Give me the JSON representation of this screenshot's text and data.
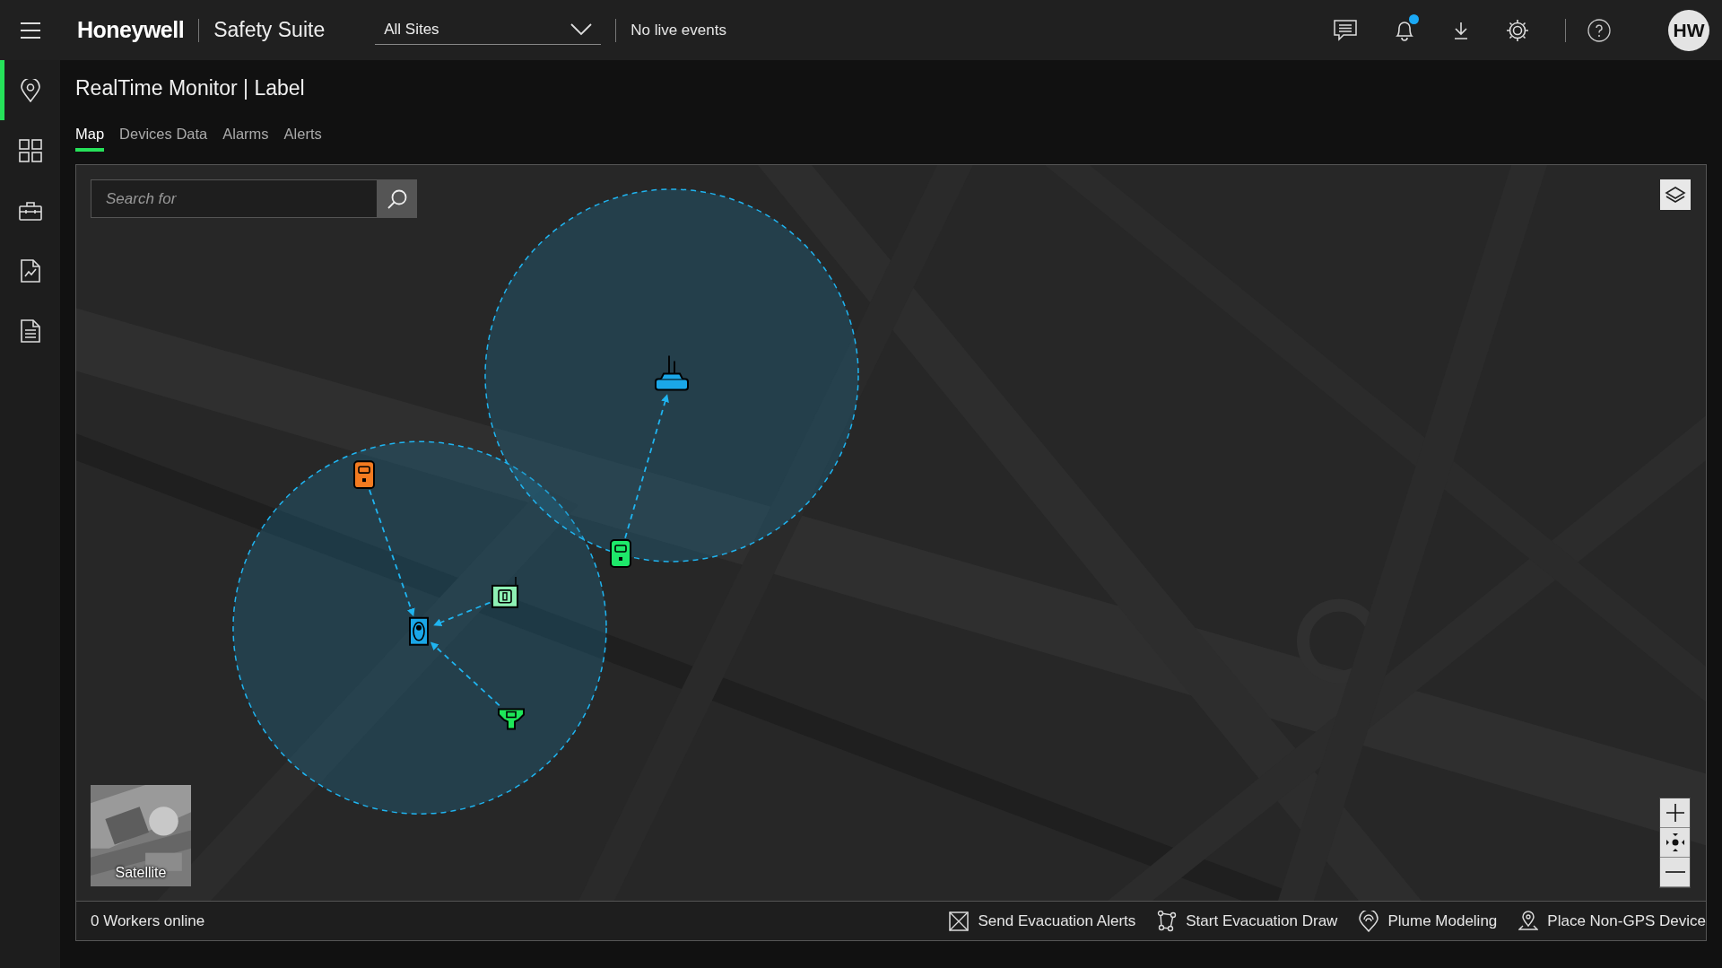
{
  "header": {
    "logo": "Honeywell",
    "app_name": "Safety Suite",
    "site_select": {
      "value": "All Sites"
    },
    "live_status": "No live events",
    "notifications_unread": true,
    "avatar": "HW"
  },
  "sidebar": {
    "items": [
      {
        "kind": "map",
        "selected": true
      },
      {
        "kind": "dashboard",
        "selected": false
      },
      {
        "kind": "toolbox",
        "selected": false
      },
      {
        "kind": "report",
        "selected": false
      },
      {
        "kind": "document",
        "selected": false
      }
    ]
  },
  "page": {
    "title": "RealTime Monitor | Label"
  },
  "tabs": [
    {
      "label": "Map",
      "selected": true
    },
    {
      "label": "Devices Data",
      "selected": false
    },
    {
      "label": "Alarms",
      "selected": false
    },
    {
      "label": "Alerts",
      "selected": false
    }
  ],
  "map": {
    "kind": "picture",
    "search": {
      "placeholder": "Search for"
    },
    "basemap_toggle": {
      "label": "Satellite"
    },
    "devices": [
      {
        "kind": "portable",
        "color": "#f47b20"
      },
      {
        "kind": "worker",
        "color": "#1aa7e8"
      },
      {
        "kind": "area-monitor",
        "color": "#8ef0b4"
      },
      {
        "kind": "fixed-sensor",
        "color": "#1ee85a"
      },
      {
        "kind": "portable",
        "color": "#1ee86a"
      },
      {
        "kind": "gateway",
        "color": "#1aa7e8"
      }
    ]
  },
  "footer": {
    "workers_online": "0 Workers online",
    "actions": [
      {
        "kind": "evacuation-alerts",
        "label": "Send Evacuation Alerts"
      },
      {
        "kind": "evacuation-draw",
        "label": "Start Evacuation Draw"
      },
      {
        "kind": "plume",
        "label": "Plume Modeling"
      },
      {
        "kind": "place-device",
        "label": "Place Non-GPS Device"
      }
    ]
  }
}
